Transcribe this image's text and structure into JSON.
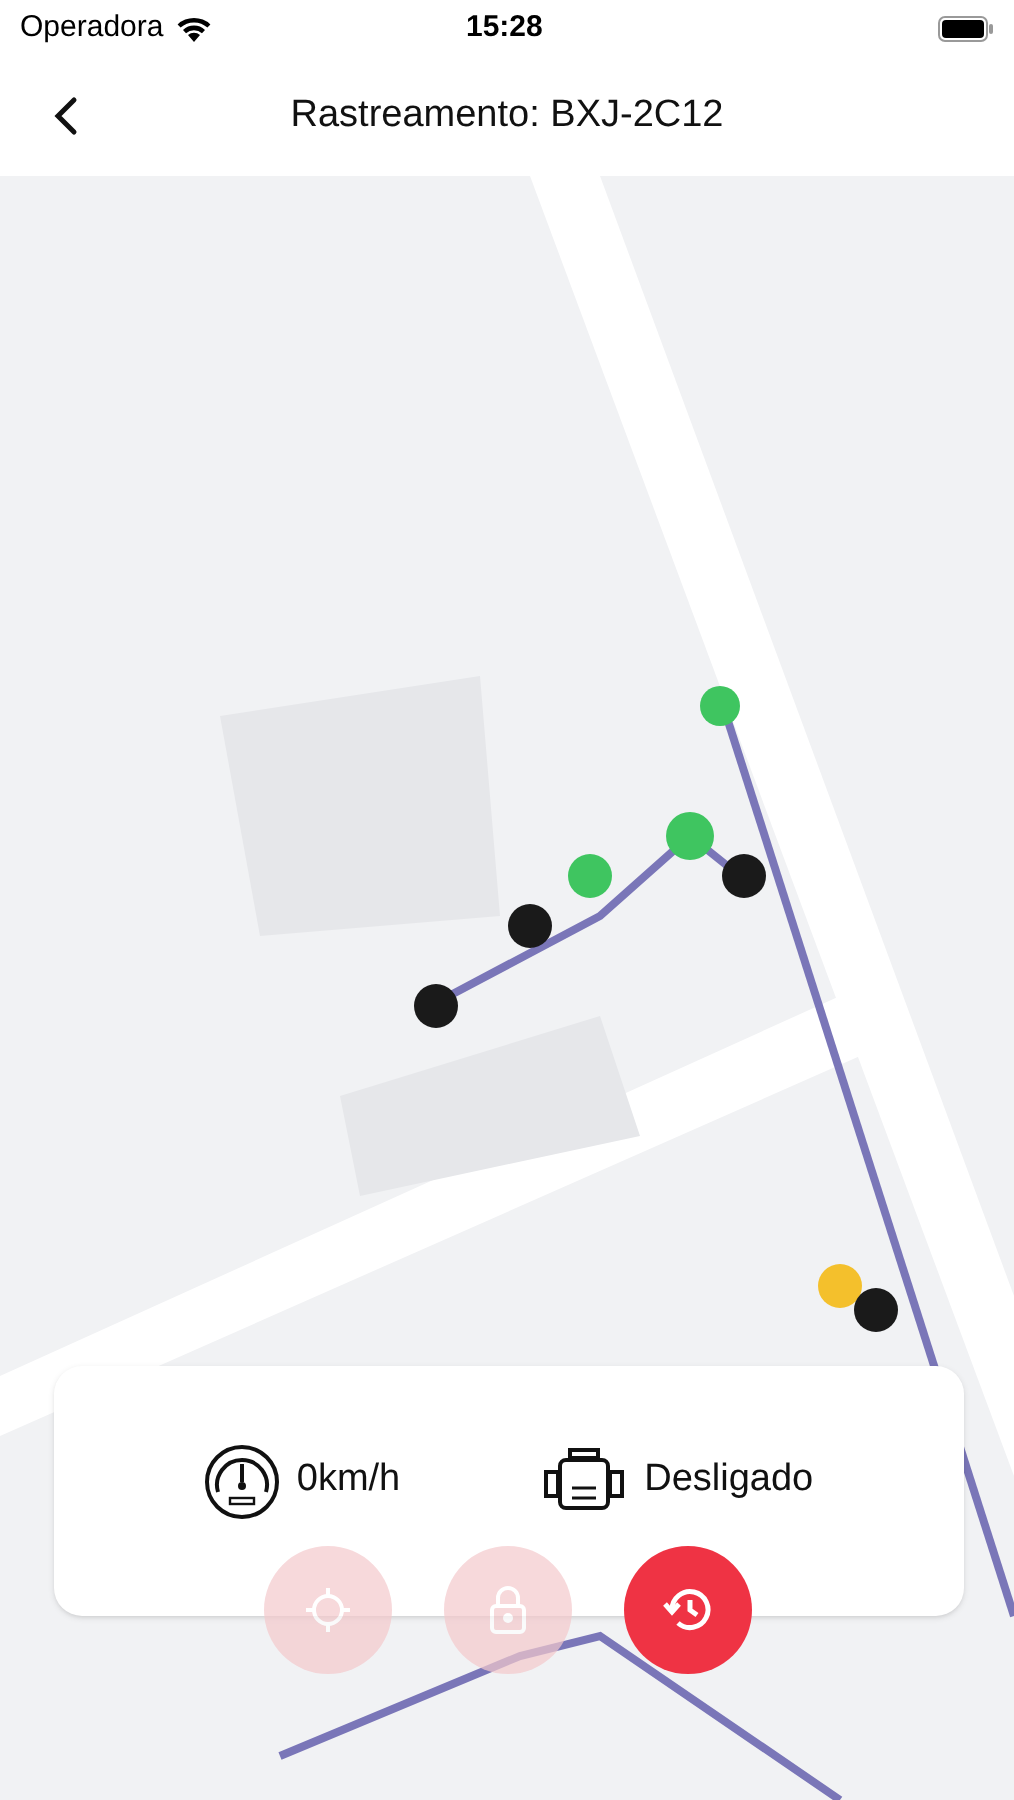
{
  "status_bar": {
    "carrier": "Operadora",
    "time": "15:28"
  },
  "header": {
    "title": "Rastreamento: BXJ-2C12"
  },
  "info_card": {
    "speed": "0km/h",
    "ignition": "Desligado"
  },
  "buttons": [
    {
      "kind": "locate",
      "disabled": true
    },
    {
      "kind": "lock",
      "disabled": true
    },
    {
      "kind": "history",
      "disabled": false
    }
  ]
}
